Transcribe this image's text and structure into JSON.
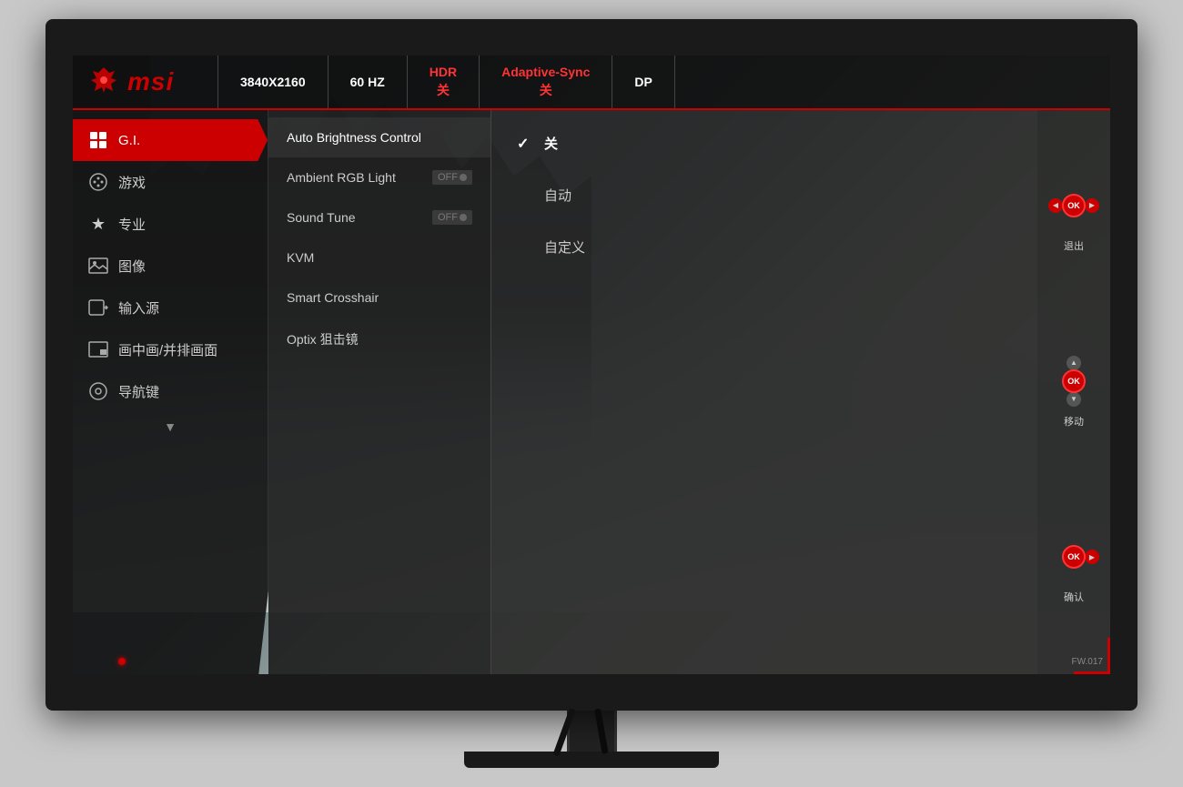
{
  "monitor": {
    "status_bar": {
      "brand": "msi",
      "resolution": "3840X2160",
      "refresh_rate": "60 HZ",
      "hdr_label": "HDR",
      "hdr_status": "关",
      "adaptive_sync_label": "Adaptive-Sync",
      "adaptive_sync_status": "关",
      "port": "DP"
    },
    "sidebar": {
      "items": [
        {
          "id": "gi",
          "label": "G.I.",
          "active": true,
          "icon": "⊞"
        },
        {
          "id": "game",
          "label": "游戏",
          "active": false,
          "icon": "🎮"
        },
        {
          "id": "pro",
          "label": "专业",
          "active": false,
          "icon": "⭐"
        },
        {
          "id": "image",
          "label": "图像",
          "active": false,
          "icon": "🖼"
        },
        {
          "id": "input",
          "label": "输入源",
          "active": false,
          "icon": "↩"
        },
        {
          "id": "pip",
          "label": "画中画/并排画面",
          "active": false,
          "icon": "⬛"
        },
        {
          "id": "navi",
          "label": "导航键",
          "active": false,
          "icon": "⊙"
        }
      ],
      "arrow_down": "▼"
    },
    "middle_panel": {
      "items": [
        {
          "id": "auto_brightness",
          "label": "Auto Brightness Control",
          "toggle": null,
          "selected": true
        },
        {
          "id": "ambient_rgb",
          "label": "Ambient RGB Light",
          "toggle": "OFF",
          "selected": false
        },
        {
          "id": "sound_tune",
          "label": "Sound Tune",
          "toggle": "OFF",
          "selected": false
        },
        {
          "id": "kvm",
          "label": "KVM",
          "toggle": null,
          "selected": false
        },
        {
          "id": "crosshair",
          "label": "Smart Crosshair",
          "toggle": null,
          "selected": false
        },
        {
          "id": "optix",
          "label": "Optix 狙击镜",
          "toggle": null,
          "selected": false
        }
      ]
    },
    "options_panel": {
      "items": [
        {
          "id": "off",
          "label": "关",
          "selected": true
        },
        {
          "id": "auto",
          "label": "自动",
          "selected": false
        },
        {
          "id": "custom",
          "label": "自定义",
          "selected": false
        }
      ]
    },
    "nav_controls": {
      "exit_group": {
        "ok_label": "OK",
        "label": "退出"
      },
      "move_group": {
        "ok_label": "OK",
        "label": "移动"
      },
      "confirm_group": {
        "ok_label": "OK",
        "label": "确认"
      },
      "firmware": "FW.017"
    }
  }
}
